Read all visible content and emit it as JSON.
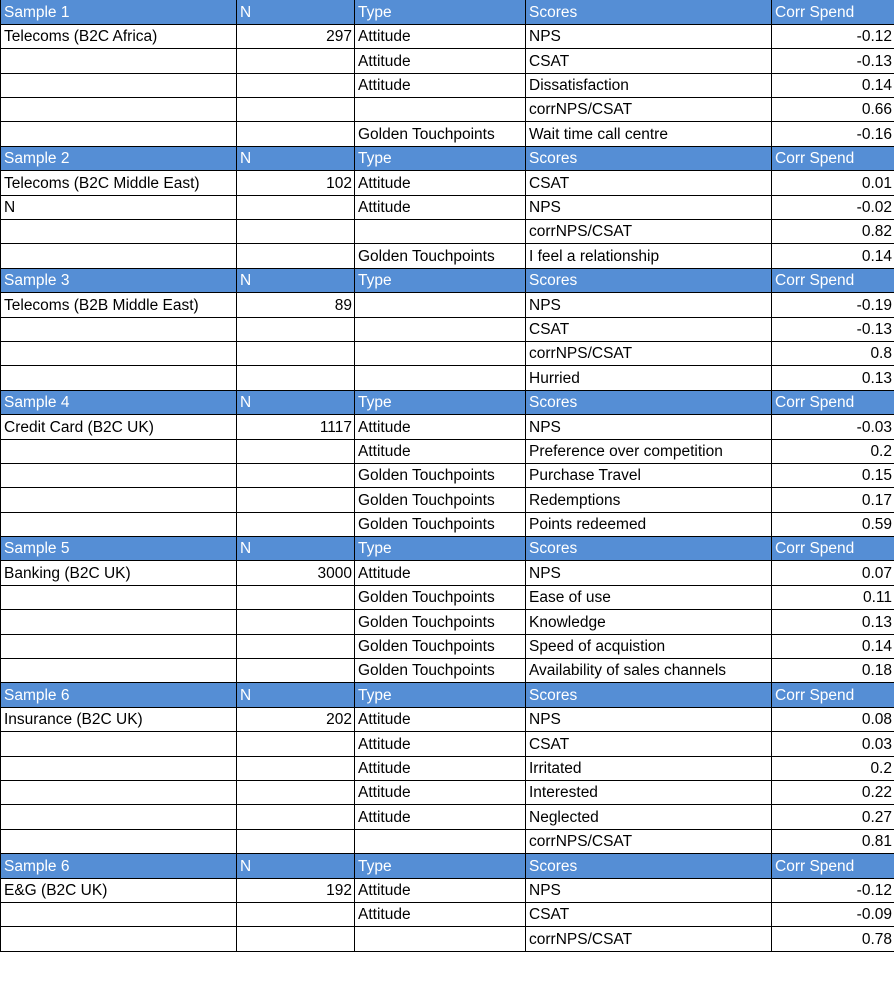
{
  "colors": {
    "header_bg": "#558ed5",
    "header_text": "#ffffff",
    "grid": "#000000"
  },
  "samples": [
    {
      "header": {
        "sample": "Sample 1",
        "n": "N",
        "type": "Type",
        "scores": "Scores",
        "corr": "Corr Spend"
      },
      "rows": [
        {
          "sector": "Telecoms (B2C Africa)",
          "n": "297",
          "type": "Attitude",
          "score": "NPS",
          "corr": "-0.12"
        },
        {
          "sector": "",
          "n": "",
          "type": "Attitude",
          "score": "CSAT",
          "corr": "-0.13"
        },
        {
          "sector": "",
          "n": "",
          "type": "Attitude",
          "score": "Dissatisfaction",
          "corr": "0.14"
        },
        {
          "sector": "",
          "n": "",
          "type": "",
          "score": "corrNPS/CSAT",
          "corr": "0.66"
        },
        {
          "sector": "",
          "n": "",
          "type": "Golden Touchpoints",
          "score": "Wait time call centre",
          "corr": "-0.16"
        }
      ]
    },
    {
      "header": {
        "sample": "Sample 2",
        "n": "N",
        "type": "Type",
        "scores": "Scores",
        "corr": "Corr Spend"
      },
      "rows": [
        {
          "sector": "Telecoms (B2C Middle East)",
          "n": "102",
          "type": "Attitude",
          "score": "CSAT",
          "corr": "0.01"
        },
        {
          "sector": "N",
          "n": "",
          "type": "Attitude",
          "score": "NPS",
          "corr": "-0.02"
        },
        {
          "sector": "",
          "n": "",
          "type": "",
          "score": "corrNPS/CSAT",
          "corr": "0.82"
        },
        {
          "sector": "",
          "n": "",
          "type": "Golden Touchpoints",
          "score": "I feel a relationship",
          "corr": "0.14"
        }
      ]
    },
    {
      "header": {
        "sample": "Sample 3",
        "n": "N",
        "type": "Type",
        "scores": "Scores",
        "corr": "Corr Spend"
      },
      "rows": [
        {
          "sector": "Telecoms (B2B Middle East)",
          "n": "89",
          "type": "",
          "score": "NPS",
          "corr": "-0.19"
        },
        {
          "sector": "",
          "n": "",
          "type": "",
          "score": "CSAT",
          "corr": "-0.13"
        },
        {
          "sector": "",
          "n": "",
          "type": "",
          "score": "corrNPS/CSAT",
          "corr": "0.8"
        },
        {
          "sector": "",
          "n": "",
          "type": "",
          "score": "Hurried",
          "corr": "0.13"
        }
      ]
    },
    {
      "header": {
        "sample": "Sample 4",
        "n": "N",
        "type": "Type",
        "scores": "Scores",
        "corr": "Corr Spend"
      },
      "rows": [
        {
          "sector": "Credit Card (B2C UK)",
          "n": "1117",
          "type": "Attitude",
          "score": "NPS",
          "corr": "-0.03"
        },
        {
          "sector": "",
          "n": "",
          "type": "Attitude",
          "score": "Preference over competition",
          "corr": "0.2"
        },
        {
          "sector": "",
          "n": "",
          "type": "Golden Touchpoints",
          "score": "Purchase Travel",
          "corr": "0.15"
        },
        {
          "sector": "",
          "n": "",
          "type": "Golden Touchpoints",
          "score": "Redemptions",
          "corr": "0.17"
        },
        {
          "sector": "",
          "n": "",
          "type": "Golden Touchpoints",
          "score": "Points redeemed",
          "corr": "0.59"
        }
      ]
    },
    {
      "header": {
        "sample": "Sample 5",
        "n": "N",
        "type": "Type",
        "scores": "Scores",
        "corr": "Corr Spend"
      },
      "rows": [
        {
          "sector": "Banking (B2C UK)",
          "n": "3000",
          "type": "Attitude",
          "score": "NPS",
          "corr": "0.07"
        },
        {
          "sector": "",
          "n": "",
          "type": "Golden Touchpoints",
          "score": "Ease of use",
          "corr": "0.11"
        },
        {
          "sector": "",
          "n": "",
          "type": "Golden Touchpoints",
          "score": "Knowledge",
          "corr": "0.13"
        },
        {
          "sector": "",
          "n": "",
          "type": "Golden Touchpoints",
          "score": "Speed of acquistion",
          "corr": "0.14"
        },
        {
          "sector": "",
          "n": "",
          "type": "Golden Touchpoints",
          "score": "Availability of sales channels",
          "corr": "0.18"
        }
      ]
    },
    {
      "header": {
        "sample": "Sample 6",
        "n": "N",
        "type": "Type",
        "scores": "Scores",
        "corr": "Corr Spend"
      },
      "rows": [
        {
          "sector": "Insurance (B2C UK)",
          "n": "202",
          "type": "Attitude",
          "score": "NPS",
          "corr": "0.08"
        },
        {
          "sector": "",
          "n": "",
          "type": "Attitude",
          "score": "CSAT",
          "corr": "0.03"
        },
        {
          "sector": "",
          "n": "",
          "type": "Attitude",
          "score": "Irritated",
          "corr": "0.2"
        },
        {
          "sector": "",
          "n": "",
          "type": "Attitude",
          "score": "Interested",
          "corr": "0.22"
        },
        {
          "sector": "",
          "n": "",
          "type": "Attitude",
          "score": "Neglected",
          "corr": "0.27"
        },
        {
          "sector": "",
          "n": "",
          "type": "",
          "score": "corrNPS/CSAT",
          "corr": "0.81"
        }
      ]
    },
    {
      "header": {
        "sample": "Sample 6",
        "n": "N",
        "type": "Type",
        "scores": "Scores",
        "corr": "Corr Spend"
      },
      "rows": [
        {
          "sector": "E&G (B2C UK)",
          "n": "192",
          "type": "Attitude",
          "score": "NPS",
          "corr": "-0.12"
        },
        {
          "sector": "",
          "n": "",
          "type": "Attitude",
          "score": "CSAT",
          "corr": "-0.09"
        },
        {
          "sector": "",
          "n": "",
          "type": "",
          "score": "corrNPS/CSAT",
          "corr": "0.78"
        }
      ]
    }
  ]
}
